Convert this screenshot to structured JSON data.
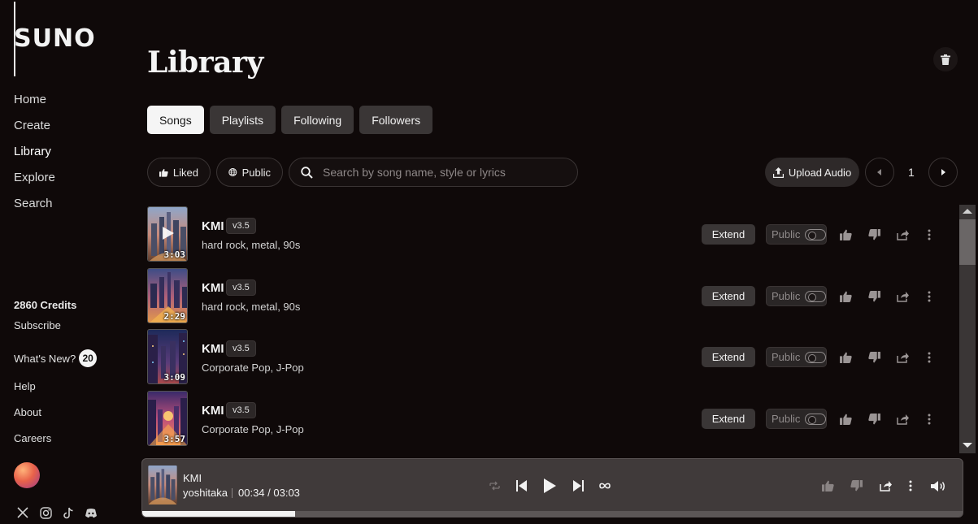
{
  "brand": {
    "logo": "SUNO"
  },
  "nav": {
    "items": [
      {
        "label": "Home"
      },
      {
        "label": "Create"
      },
      {
        "label": "Library",
        "active": true
      },
      {
        "label": "Explore"
      },
      {
        "label": "Search"
      }
    ]
  },
  "account": {
    "credits": "2860 Credits",
    "subscribe": "Subscribe",
    "whats_new": "What's New?",
    "whats_new_count": "20"
  },
  "footer_links": {
    "help": "Help",
    "about": "About",
    "careers": "Careers"
  },
  "socials": [
    "x-icon",
    "instagram-icon",
    "tiktok-icon",
    "discord-icon"
  ],
  "page": {
    "title": "Library"
  },
  "tabs": [
    {
      "label": "Songs",
      "active": true
    },
    {
      "label": "Playlists"
    },
    {
      "label": "Following"
    },
    {
      "label": "Followers"
    }
  ],
  "filters": {
    "liked": "Liked",
    "public": "Public",
    "search_placeholder": "Search by song name, style or lyrics",
    "upload": "Upload Audio",
    "page_number": "1"
  },
  "songs": [
    {
      "title": "KMI",
      "version": "v3.5",
      "style": "hard rock, metal, 90s",
      "duration": "3:03",
      "extend": "Extend",
      "visibility": "Public",
      "is_public": false,
      "playing": true
    },
    {
      "title": "KMI",
      "version": "v3.5",
      "style": "hard rock, metal, 90s",
      "duration": "2:29",
      "extend": "Extend",
      "visibility": "Public",
      "is_public": false
    },
    {
      "title": "KMI",
      "version": "v3.5",
      "style": "Corporate Pop, J-Pop",
      "duration": "3:09",
      "extend": "Extend",
      "visibility": "Public",
      "is_public": false
    },
    {
      "title": "KMI",
      "version": "v3.5",
      "style": "Corporate Pop, J-Pop",
      "duration": "3:57",
      "extend": "Extend",
      "visibility": "Public",
      "is_public": false
    }
  ],
  "player": {
    "title": "KMI",
    "artist": "yoshitaka",
    "time": "00:34 / 03:03",
    "progress": 0.186
  },
  "colors": {
    "background": "#0f0909",
    "button": "#3a3636",
    "active_tab": "#f5f5f5",
    "player_bg": "#403a3a"
  }
}
